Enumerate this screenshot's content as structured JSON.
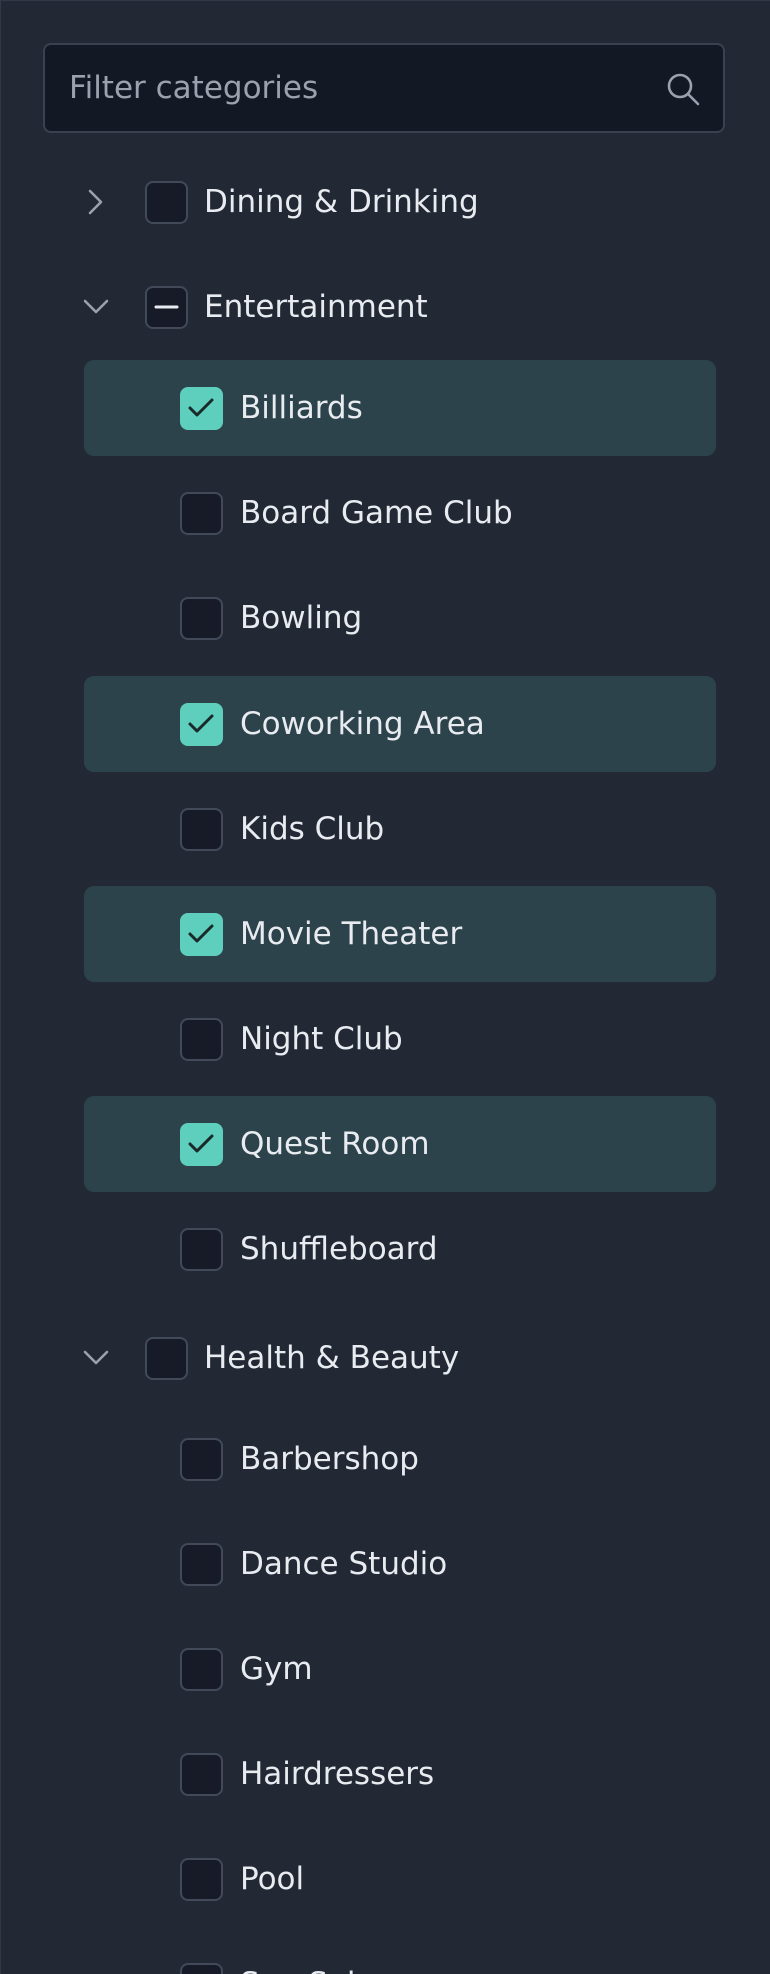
{
  "search": {
    "placeholder": "Filter categories",
    "icon": "search-icon"
  },
  "colors": {
    "panel": "#222834",
    "accent": "#5ecfbc",
    "selected_row": "#2c434b",
    "text": "#e8ebf0"
  },
  "tree": [
    {
      "label": "Dining & Drinking",
      "expanded": false,
      "state": "unchecked",
      "children": []
    },
    {
      "label": "Entertainment",
      "expanded": true,
      "state": "indeterminate",
      "children": [
        {
          "label": "Billiards",
          "checked": true
        },
        {
          "label": "Board Game Club",
          "checked": false
        },
        {
          "label": "Bowling",
          "checked": false
        },
        {
          "label": "Coworking Area",
          "checked": true
        },
        {
          "label": "Kids Club",
          "checked": false
        },
        {
          "label": "Movie Theater",
          "checked": true
        },
        {
          "label": "Night Club",
          "checked": false
        },
        {
          "label": "Quest Room",
          "checked": true
        },
        {
          "label": "Shuffleboard",
          "checked": false
        }
      ]
    },
    {
      "label": "Health & Beauty",
      "expanded": true,
      "state": "unchecked",
      "children": [
        {
          "label": "Barbershop",
          "checked": false
        },
        {
          "label": "Dance Studio",
          "checked": false
        },
        {
          "label": "Gym",
          "checked": false
        },
        {
          "label": "Hairdressers",
          "checked": false
        },
        {
          "label": "Pool",
          "checked": false
        },
        {
          "label": "Spa Salon",
          "checked": false
        }
      ]
    }
  ]
}
